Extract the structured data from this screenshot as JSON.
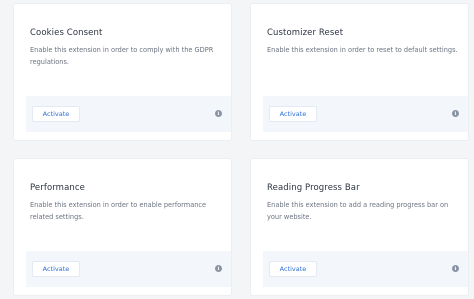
{
  "cards": [
    {
      "title": "Cookies Consent",
      "description": "Enable this extension in order to comply with the GDPR regulations.",
      "button_label": "Activate",
      "info_icon": "info-icon"
    },
    {
      "title": "Customizer Reset",
      "description": "Enable this extension in order to reset to default settings.",
      "button_label": "Activate",
      "info_icon": "info-icon"
    },
    {
      "title": "Performance",
      "description": "Enable this extension in order to enable performance related settings.",
      "button_label": "Activate",
      "info_icon": "info-icon"
    },
    {
      "title": "Reading Progress Bar",
      "description": "Enable this extension to add a reading progress bar on your website.",
      "button_label": "Activate",
      "info_icon": "info-icon"
    }
  ],
  "colors": {
    "accent": "#2d6fd6",
    "footer_bg": "#f3f7fc",
    "page_bg": "#f4f5f7"
  }
}
